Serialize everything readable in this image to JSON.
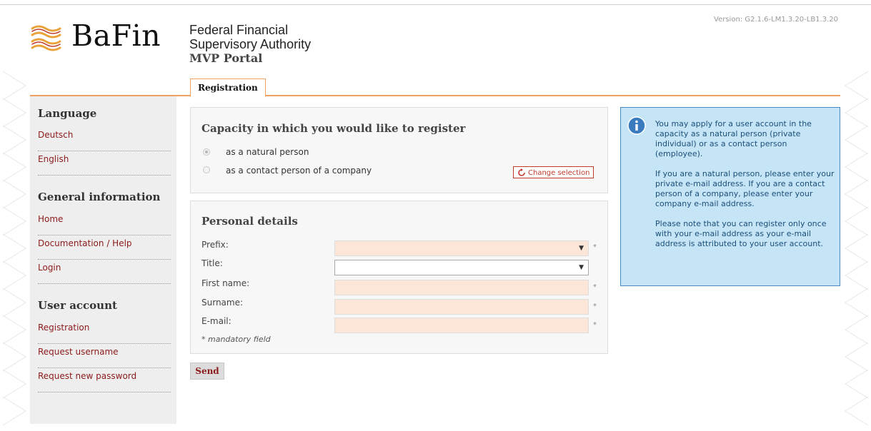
{
  "header": {
    "logo_text": "BaFin",
    "authority_line1": "Federal Financial",
    "authority_line2": "Supervisory Authority",
    "portal_name": "MVP Portal",
    "version": "Version: G2.1.6-LM1.3.20-LB1.3.20"
  },
  "tabs": {
    "active": "Registration"
  },
  "sidebar": {
    "language_heading": "Language",
    "language_items": [
      "Deutsch",
      "English"
    ],
    "general_heading": "General information",
    "general_items": [
      "Home",
      "Documentation / Help",
      "Login"
    ],
    "account_heading": "User account",
    "account_items": [
      "Registration",
      "Request username",
      "Request new password"
    ]
  },
  "capacity": {
    "heading": "Capacity in which you would like to register",
    "option_natural": "as a natural person",
    "option_contact": "as a contact person of a company",
    "selected": "natural",
    "change_button": "Change selection"
  },
  "personal": {
    "heading": "Personal details",
    "prefix_label": "Prefix:",
    "prefix_value": "",
    "title_label": "Title:",
    "title_value": "",
    "firstname_label": "First name:",
    "firstname_value": "",
    "surname_label": "Surname:",
    "surname_value": "",
    "email_label": "E-mail:",
    "email_value": "",
    "required_marker": "*",
    "mandatory_note": "* mandatory field"
  },
  "actions": {
    "send_label": "Send"
  },
  "info": {
    "paragraph1": "You may apply for a user account in the capacity as a natural person (private individual) or as a contact person (employee).",
    "paragraph2": "If you are a natural person, please enter your private e-mail address. If you are a contact person of a company, please enter your company e-mail address.",
    "paragraph3": "Please note that you can register only once with your e-mail address as your e-mail address is attributed to your user account."
  },
  "colors": {
    "accent_orange": "#f0a060",
    "link_red": "#8b1a1a",
    "info_blue_bg": "#c5e4f6",
    "info_blue_border": "#4a8ac4",
    "field_peach": "#fbe6d7"
  },
  "icons": {
    "logo_mark": "bafin-waves-icon",
    "change": "refresh-icon",
    "info": "info-icon",
    "dropdown": "chevron-down-icon"
  }
}
